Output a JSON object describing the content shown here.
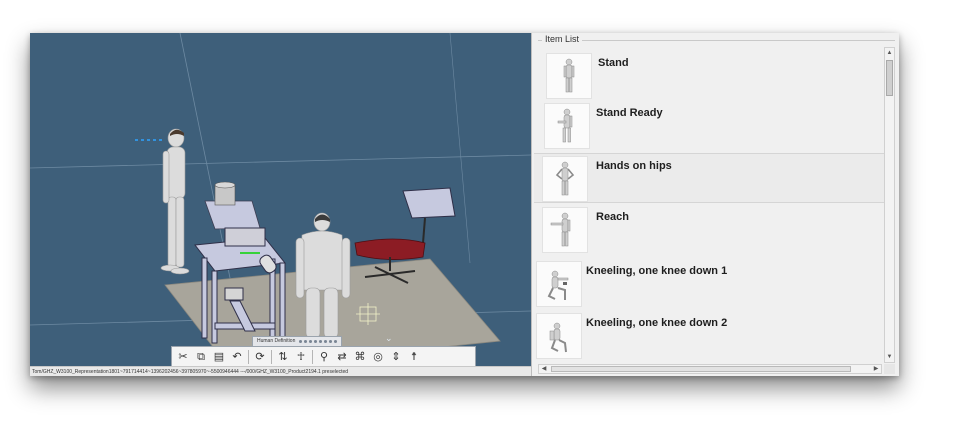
{
  "viewport": {
    "status_text": "Tom/GHZ_W3100_Representation1801~791714414~1396202456~397805970~-5500946444 ---/000/GHZ_W3100_Product2194.1 preselected",
    "human_definition_label": "Human Definition",
    "toolbar_icons": [
      "scissors-icon",
      "copy-icon",
      "paste-icon",
      "undo-icon",
      "refresh-icon",
      "manikin-mirror-icon",
      "manikin-posture-icon",
      "manikin-pose-icon",
      "manikin-swap-icon",
      "manikin-attach-icon",
      "target-icon",
      "manikin-align-icon",
      "manikin-stand-icon"
    ]
  },
  "item_list": {
    "title": "Item List",
    "items": [
      {
        "label": "Stand",
        "pose": "stand"
      },
      {
        "label": "Stand Ready",
        "pose": "stand-ready"
      },
      {
        "label": "Hands on hips",
        "pose": "hands-on-hips"
      },
      {
        "label": "Reach",
        "pose": "reach"
      },
      {
        "label": "Kneeling, one knee down 1",
        "pose": "kneel-1"
      },
      {
        "label": "Kneeling, one knee down 2",
        "pose": "kneel-2"
      }
    ]
  },
  "colors": {
    "viewport_bg": "#3e5f7a",
    "floor": "#a8a59b",
    "chair_seat": "#8c1c24",
    "desk": "#c6c9df"
  }
}
